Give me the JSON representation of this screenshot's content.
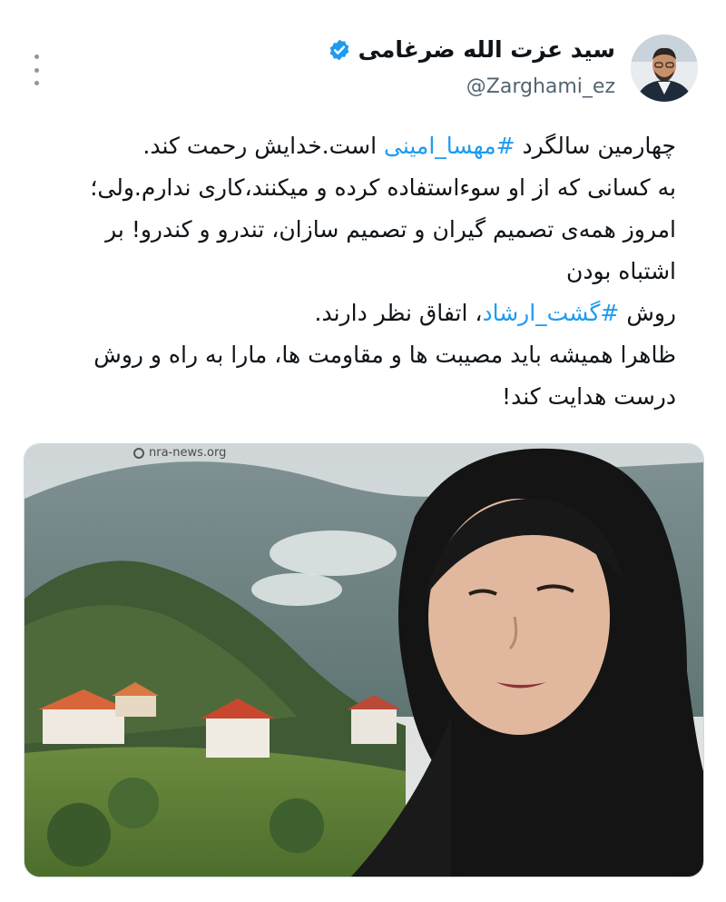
{
  "author": {
    "display_name": "سید عزت الله ضرغامی",
    "handle": "@Zarghami_ez",
    "verified": true
  },
  "tweet": {
    "line1": {
      "pre": "چهارمین سالگرد ",
      "hashtag": "#مهسا_امینی",
      "post": " است.خدایش رحمت کند."
    },
    "line2": "به کسانی که از او سوءاستفاده کرده و میکنند،کاری ندارم.ولی؛",
    "line3": "امروز همه‌ی تصمیم گیران و تصمیم سازان، تندرو و کندرو! بر",
    "line4": "اشتباه بودن",
    "line5": {
      "pre": "روش ",
      "hashtag": "#گشت_ارشاد",
      "post": "، اتفاق نظر دارند."
    },
    "line6": "ظاهرا همیشه باید مصیبت ها و مقاومت ها، مارا به راه و روش",
    "line7": "درست هدایت کند!"
  },
  "media": {
    "watermark": "nra-news.org"
  },
  "colors": {
    "hashtag": "#1d9bf0",
    "verified_badge": "#1d9bf0",
    "text": "#0f1419",
    "secondary": "#536471"
  },
  "icons": {
    "more": "vertical-ellipsis-icon",
    "verified": "verified-badge-icon"
  }
}
